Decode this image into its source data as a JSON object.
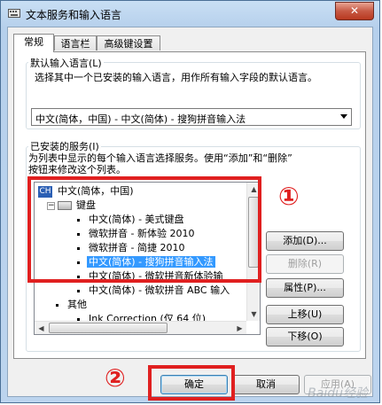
{
  "window": {
    "title": "文本服务和输入语言",
    "close_label": "✕"
  },
  "tabs": [
    {
      "label": "常规"
    },
    {
      "label": "语言栏"
    },
    {
      "label": "高级键设置"
    }
  ],
  "default_language": {
    "group_label": "默认输入语言(L)",
    "description": "选择其中一个已安装的输入语言，用作所有输入字段的默认语言。",
    "selected_value": "中文(简体，中国) - 中文(简体) - 搜狗拼音输入法"
  },
  "installed_services": {
    "group_label": "已安装的服务(I)",
    "description_line1": "为列表中显示的每个输入语言选择服务。使用“添加”和“删除”",
    "description_line2": "按钮来修改这个列表。",
    "lang_badge": "CH",
    "tree": [
      {
        "text": "中文(简体，中国)"
      },
      {
        "text": "键盘"
      },
      {
        "text": "中文(简体) - 美式键盘"
      },
      {
        "text": "微软拼音 - 新体验 2010"
      },
      {
        "text": "微软拼音 - 简捷 2010"
      },
      {
        "text": "中文(简体) - 搜狗拼音输入法"
      },
      {
        "text": "中文(简体) - 微软拼音新体验输"
      },
      {
        "text": "中文(简体) - 微软拼音 ABC 输入"
      },
      {
        "text": "其他"
      },
      {
        "text": "Ink Correction (仅 64 位)"
      }
    ]
  },
  "side_buttons": {
    "add": "添加(D)...",
    "remove": "删除(R)",
    "properties": "属性(P)...",
    "move_up": "上移(U)",
    "move_down": "下移(O)"
  },
  "footer_buttons": {
    "ok": "确定",
    "cancel": "取消",
    "apply": "应用(A)"
  },
  "annotations": {
    "marker1": "①",
    "marker2": "②",
    "color": "#e02020"
  },
  "watermark": "Baidu经验"
}
